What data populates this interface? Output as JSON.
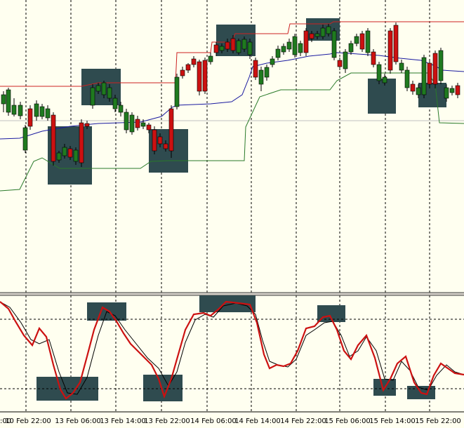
{
  "colors": {
    "background": "#fffff0",
    "bull_candle": "#1f7a1f",
    "bear_candle": "#cc1111",
    "upper_band": "#cc2222",
    "middle_band": "#1a1aa0",
    "lower_band": "#2a7a2a",
    "highlight_box": "#2f4b4f",
    "osc_main": "#cc1111",
    "osc_signal": "#000000",
    "grid": "#000000"
  },
  "chart_data": [
    {
      "type": "candlestick",
      "panel": "price",
      "grid": "vertical dotted at date separators",
      "bands": [
        "upper",
        "middle",
        "lower"
      ],
      "highlight_zones": 8
    },
    {
      "type": "line",
      "panel": "oscillator",
      "series": [
        {
          "line": "main"
        },
        {
          "line": "signal"
        }
      ],
      "levels": "two dashed horizontal levels",
      "highlight_zones": 8
    }
  ],
  "x_axis": {
    "labels": [
      "10 Feb 22:00",
      "13 Feb 06:00",
      "13 Feb 14:00",
      "13 Feb 22:00",
      "14 Feb 06:00",
      "14 Feb 14:00",
      "14 Feb 22:00",
      "15 Feb 06:00",
      "15 Feb 14:00",
      "15 Feb 22:00"
    ],
    "first_label_fragment": ":00"
  }
}
